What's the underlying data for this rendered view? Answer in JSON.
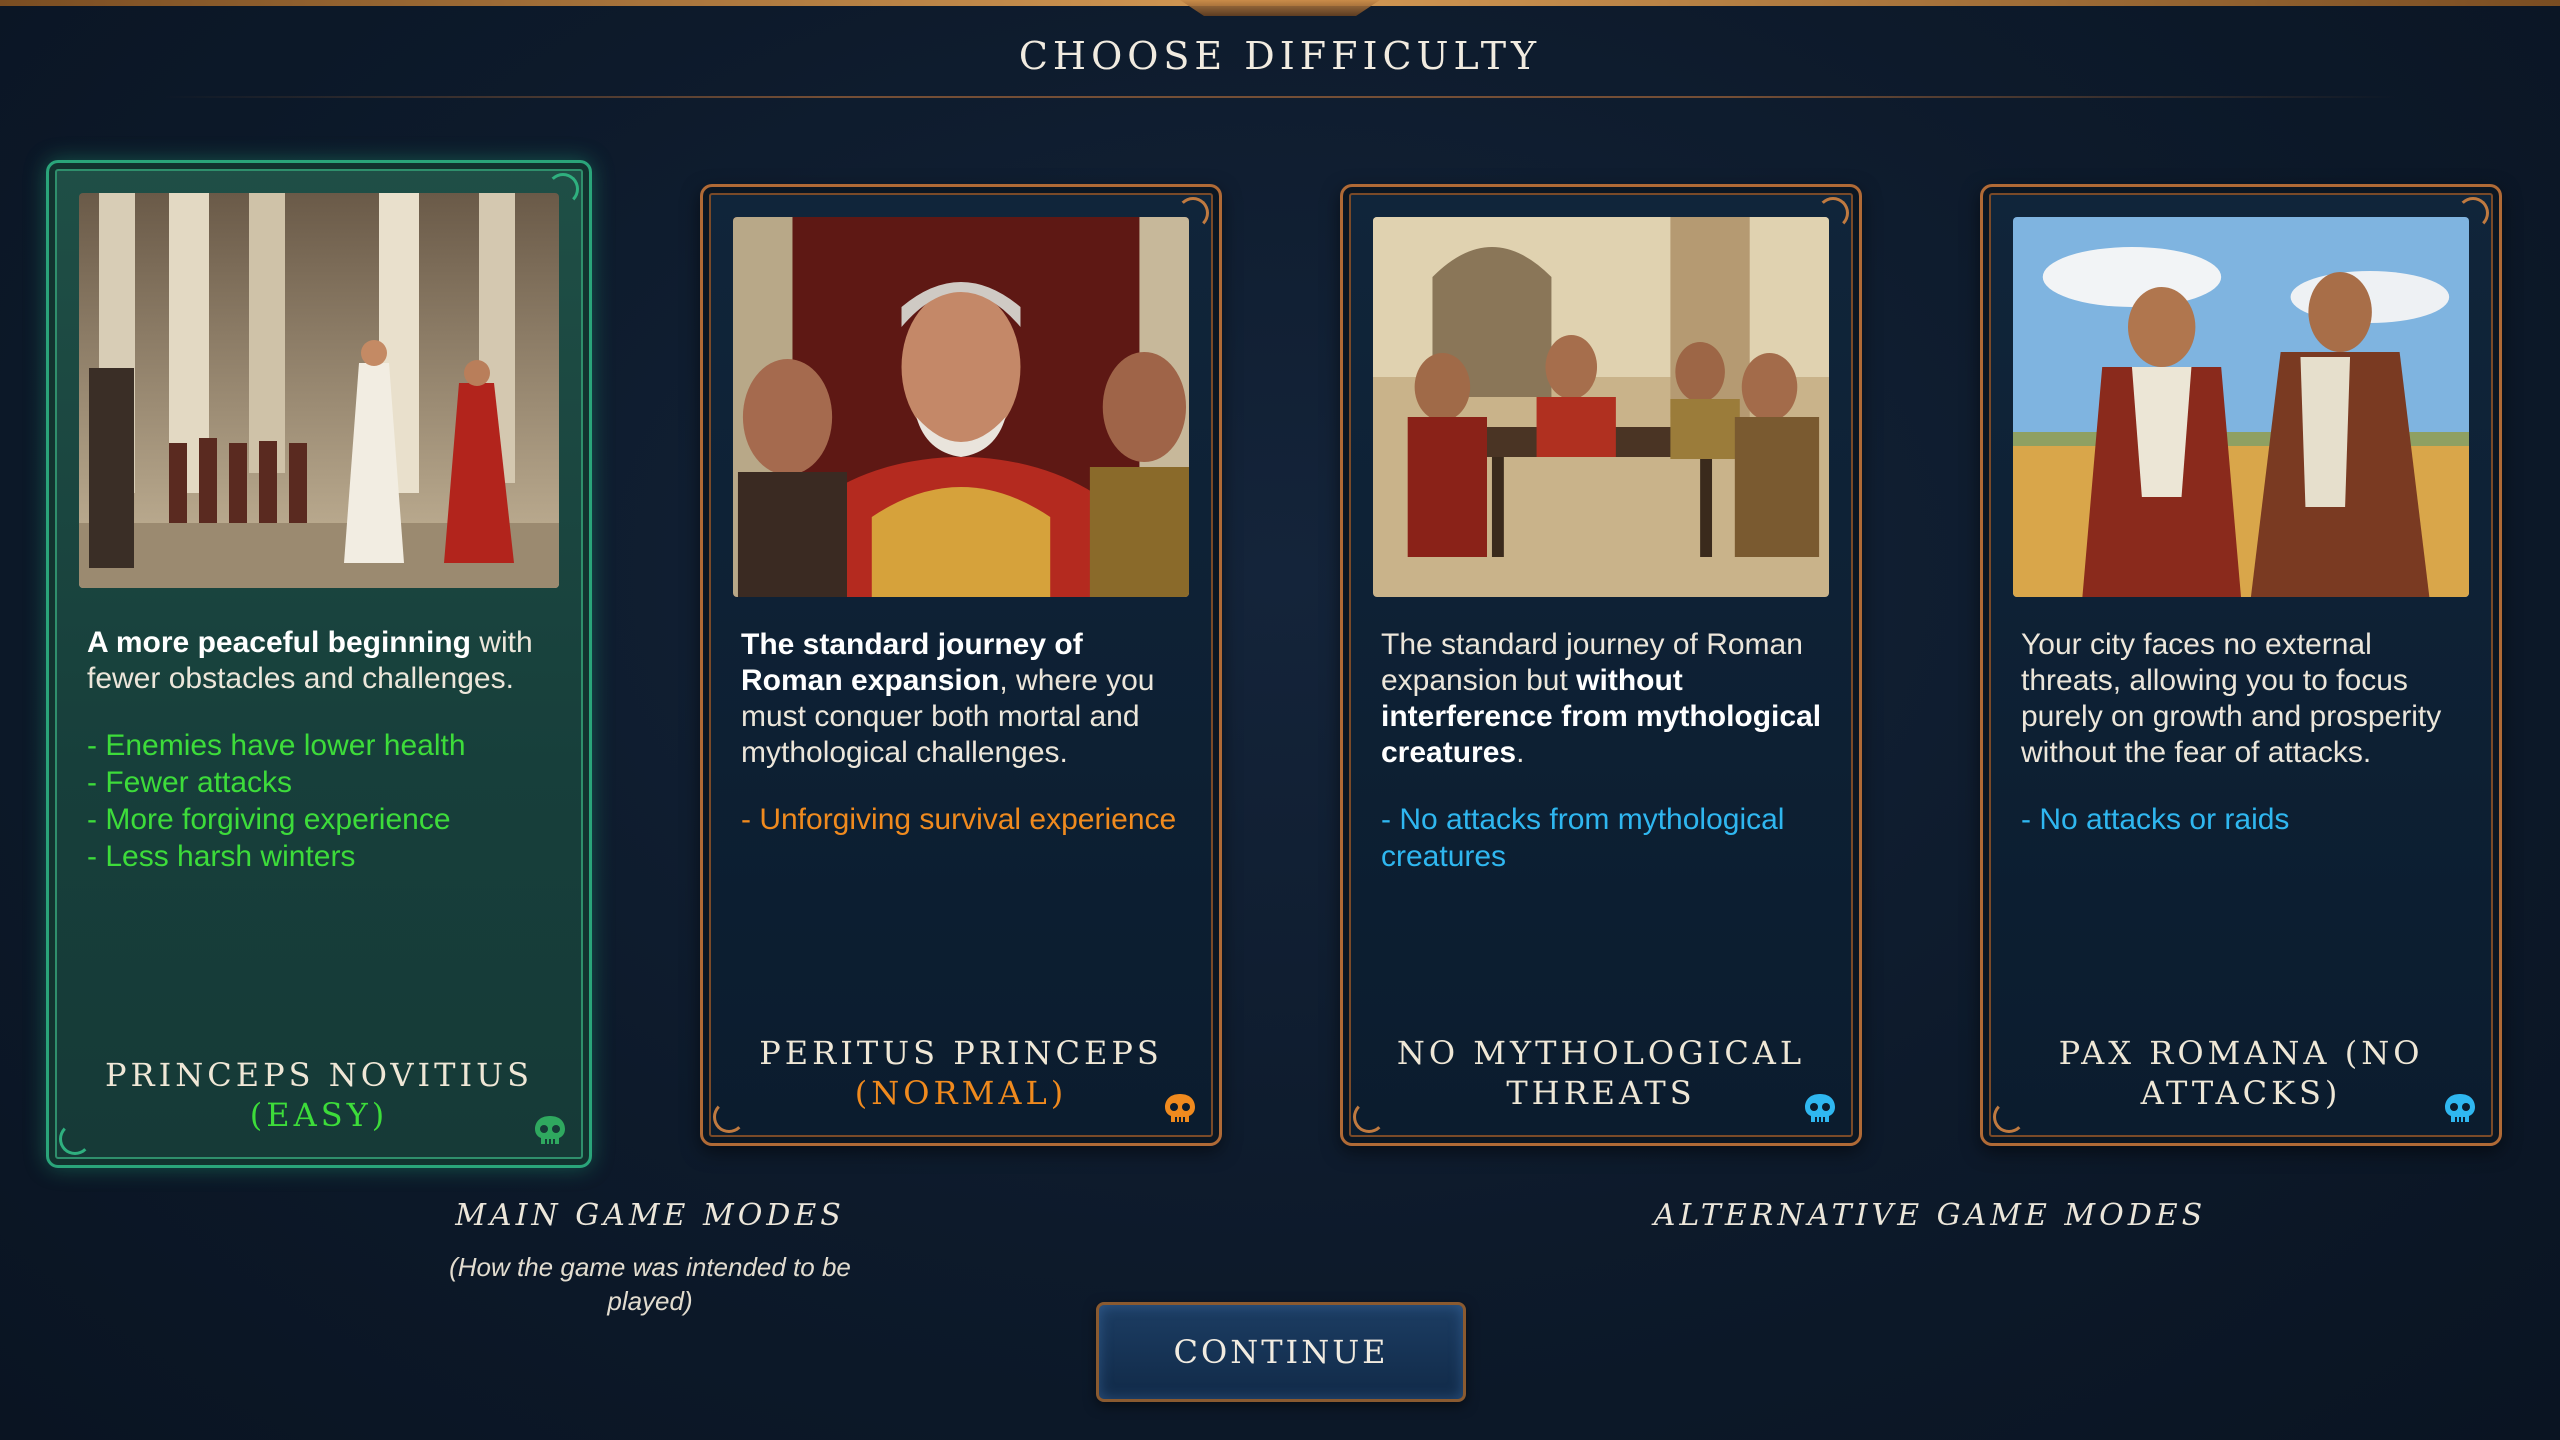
{
  "screen": {
    "title": "CHOOSE DIFFICULTY"
  },
  "colors": {
    "easy": "#3ddc3a",
    "normal": "#f08a1e",
    "alt": "#2fb7f0",
    "selected_border": "#2aa57a",
    "card_border": "#b06a36"
  },
  "cards": [
    {
      "name_line1": "PRINCEPS NOVITIUS",
      "name_line2": "(EASY)",
      "desc_bold": "A more peaceful beginning",
      "desc_rest": " with fewer obstacles and challenges.",
      "bullets": [
        "- Enemies have lower health",
        "- Fewer attacks",
        "- More forgiving experience",
        "- Less harsh winters"
      ],
      "selected": true,
      "skull_icon": "skull-icon"
    },
    {
      "name_line1": "PERITUS PRINCEPS",
      "name_line2": "(NORMAL)",
      "desc_bold": "The standard journey of Roman expansion",
      "desc_rest": ", where you must conquer both mortal and mythological challenges.",
      "bullets": [
        "- Unforgiving survival experience"
      ],
      "selected": false,
      "skull_icon": "skull-icon"
    },
    {
      "name_line1": "NO MYTHOLOGICAL",
      "name_line2": "THREATS",
      "desc_pre": "The standard journey of Roman expansion but ",
      "desc_bold": "without interference from mythological creatures",
      "desc_post": ".",
      "bullets": [
        "- No attacks from mythological creatures"
      ],
      "selected": false,
      "skull_icon": "skull-icon"
    },
    {
      "name_line1": "PAX ROMANA (NO",
      "name_line2": "ATTACKS)",
      "desc_plain": "Your city faces no external threats, allowing you to focus purely on growth and prosperity without the fear of attacks.",
      "bullets": [
        "- No attacks or raids"
      ],
      "selected": false,
      "skull_icon": "skull-icon"
    }
  ],
  "sections": {
    "main_label": "MAIN GAME MODES",
    "main_note": "(How the game was intended to be played)",
    "alt_label": "ALTERNATIVE GAME MODES"
  },
  "continue_label": "CONTINUE"
}
